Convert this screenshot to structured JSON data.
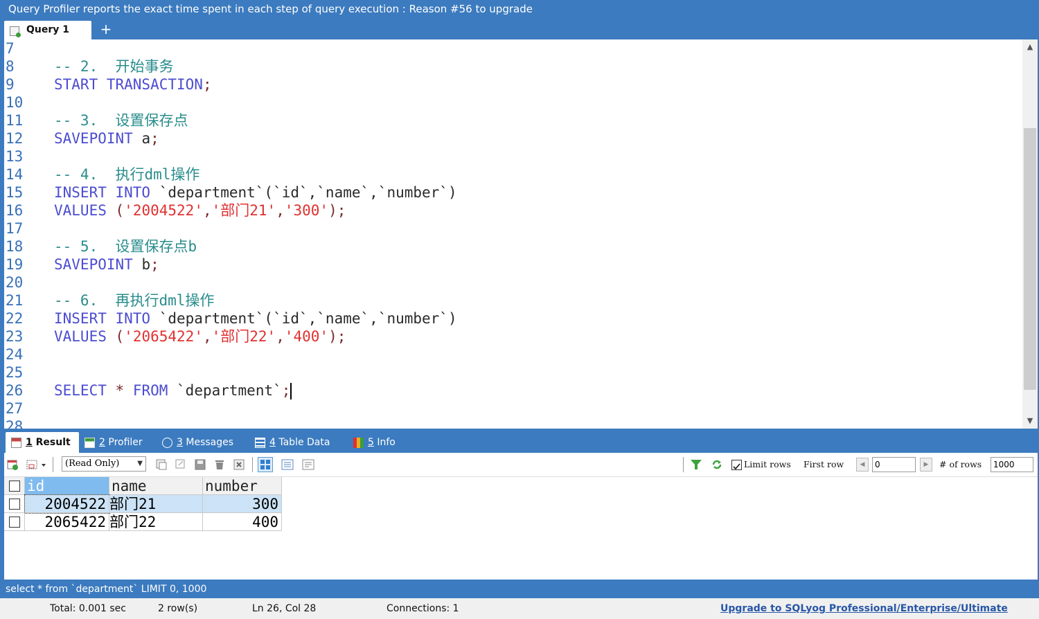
{
  "banner": {
    "text": "Query Profiler reports the exact time spent in each step of query execution : Reason #56 to upgrade"
  },
  "query_tabs": {
    "active_label": "Query 1",
    "add_label": "+"
  },
  "editor": {
    "lines": [
      {
        "n": "7",
        "segs": []
      },
      {
        "n": "8",
        "segs": [
          {
            "c": "cm",
            "t": "-- 2.  开始事务"
          }
        ]
      },
      {
        "n": "9",
        "segs": [
          {
            "c": "kw",
            "t": "START TRANSACTION"
          },
          {
            "c": "pn",
            "t": ";"
          }
        ]
      },
      {
        "n": "10",
        "segs": []
      },
      {
        "n": "11",
        "segs": [
          {
            "c": "cm",
            "t": "-- 3.  设置保存点"
          }
        ]
      },
      {
        "n": "12",
        "segs": [
          {
            "c": "kw",
            "t": "SAVEPOINT "
          },
          {
            "c": "id",
            "t": "a"
          },
          {
            "c": "pn",
            "t": ";"
          }
        ]
      },
      {
        "n": "13",
        "segs": []
      },
      {
        "n": "14",
        "segs": [
          {
            "c": "cm",
            "t": "-- 4.  执行dml操作"
          }
        ]
      },
      {
        "n": "15",
        "segs": [
          {
            "c": "kw",
            "t": "INSERT INTO "
          },
          {
            "c": "id",
            "t": "`department`(`id`,`name`,`number`)"
          }
        ]
      },
      {
        "n": "16",
        "segs": [
          {
            "c": "kw",
            "t": "VALUES "
          },
          {
            "c": "pn",
            "t": "("
          },
          {
            "c": "str",
            "t": "'2004522'"
          },
          {
            "c": "pn",
            "t": ","
          },
          {
            "c": "str",
            "t": "'部门21'"
          },
          {
            "c": "pn",
            "t": ","
          },
          {
            "c": "str",
            "t": "'300'"
          },
          {
            "c": "pn",
            "t": ");"
          }
        ]
      },
      {
        "n": "17",
        "segs": []
      },
      {
        "n": "18",
        "segs": [
          {
            "c": "cm",
            "t": "-- 5.  设置保存点b"
          }
        ]
      },
      {
        "n": "19",
        "segs": [
          {
            "c": "kw",
            "t": "SAVEPOINT "
          },
          {
            "c": "id",
            "t": "b"
          },
          {
            "c": "pn",
            "t": ";"
          }
        ]
      },
      {
        "n": "20",
        "segs": []
      },
      {
        "n": "21",
        "segs": [
          {
            "c": "cm",
            "t": "-- 6.  再执行dml操作"
          }
        ]
      },
      {
        "n": "22",
        "segs": [
          {
            "c": "kw",
            "t": "INSERT INTO "
          },
          {
            "c": "id",
            "t": "`department`(`id`,`name`,`number`)"
          }
        ]
      },
      {
        "n": "23",
        "segs": [
          {
            "c": "kw",
            "t": "VALUES "
          },
          {
            "c": "pn",
            "t": "("
          },
          {
            "c": "str",
            "t": "'2065422'"
          },
          {
            "c": "pn",
            "t": ","
          },
          {
            "c": "str",
            "t": "'部门22'"
          },
          {
            "c": "pn",
            "t": ","
          },
          {
            "c": "str",
            "t": "'400'"
          },
          {
            "c": "pn",
            "t": ");"
          }
        ]
      },
      {
        "n": "24",
        "segs": []
      },
      {
        "n": "25",
        "segs": []
      },
      {
        "n": "26",
        "segs": [
          {
            "c": "kw",
            "t": "SELECT "
          },
          {
            "c": "pn",
            "t": "* "
          },
          {
            "c": "kw",
            "t": "FROM "
          },
          {
            "c": "id",
            "t": "`department`"
          },
          {
            "c": "pn",
            "t": ";"
          }
        ],
        "caret": true
      },
      {
        "n": "27",
        "segs": []
      },
      {
        "n": "28",
        "segs": []
      }
    ]
  },
  "result_tabs": [
    {
      "num": "1",
      "label": " Result",
      "icon": "grid-result-icon",
      "active": true
    },
    {
      "num": "2",
      "label": " Profiler",
      "icon": "profiler-icon",
      "active": false
    },
    {
      "num": "3",
      "label": " Messages",
      "icon": "info-circle-icon",
      "active": false
    },
    {
      "num": "4",
      "label": " Table Data",
      "icon": "table-icon",
      "active": false
    },
    {
      "num": "5",
      "label": " Info",
      "icon": "info-chart-icon",
      "active": false
    }
  ],
  "toolbar": {
    "mode_select": "(Read Only)",
    "limit_rows_label": "Limit rows",
    "limit_checked": true,
    "first_row_label": "First row",
    "first_row_value": "0",
    "num_rows_label": "# of rows",
    "num_rows_value": "1000"
  },
  "result_grid": {
    "columns": [
      "id",
      "name",
      "number"
    ],
    "rows": [
      {
        "id": "2004522",
        "name": "部门21",
        "number": "300",
        "selected": true
      },
      {
        "id": "2065422",
        "name": "部门22",
        "number": "400",
        "selected": false
      }
    ]
  },
  "sql_status": "select * from `department` LIMIT 0, 1000",
  "status": {
    "total": "Total: 0.001 sec",
    "rows": "2 row(s)",
    "position": "Ln 26, Col 28",
    "connections": "Connections: 1",
    "upgrade": "Upgrade to SQLyog Professional/Enterprise/Ultimate"
  },
  "colors": {
    "chrome_blue": "#3c7bbf",
    "keyword": "#4c4cd0",
    "comment": "#2a8c8c",
    "string": "#e03030",
    "line_number": "#3770b8",
    "header_selected": "#7fbbee",
    "row_selected": "#cce3f7"
  }
}
